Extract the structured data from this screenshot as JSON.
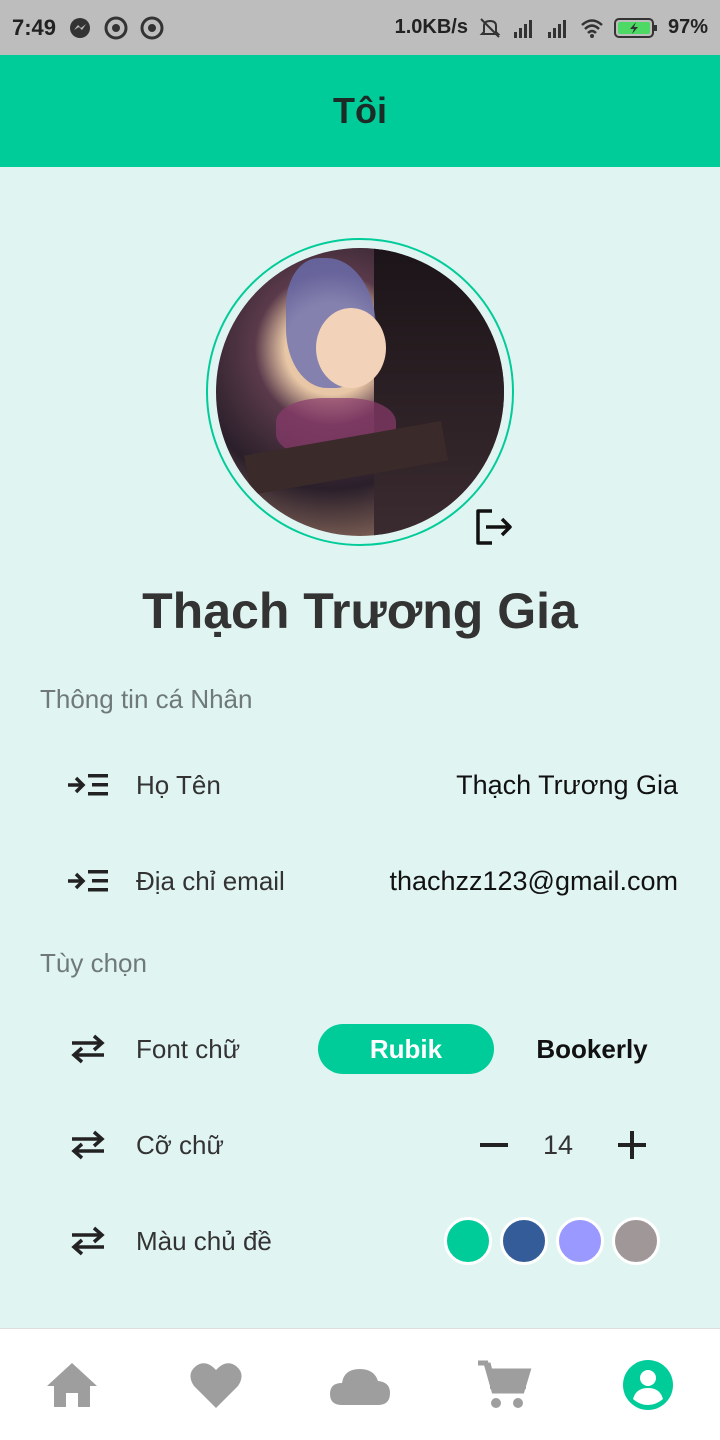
{
  "status_bar": {
    "time": "7:49",
    "network_speed": "1.0KB/s",
    "battery": "97%",
    "icons": [
      "messenger-icon",
      "app-icon",
      "app-icon",
      "mute-icon",
      "signal-icon",
      "signal-icon",
      "wifi-icon",
      "battery-icon"
    ]
  },
  "header": {
    "title": "Tôi"
  },
  "profile": {
    "name": "Thạch Trương Gia",
    "avatar": "avatar-image",
    "logout_icon": "logout-icon"
  },
  "personal_section": {
    "title": "Thông tin cá Nhân",
    "rows": [
      {
        "icon": "indent-icon",
        "label": "Họ Tên",
        "value": "Thạch Trương Gia"
      },
      {
        "icon": "indent-icon",
        "label": "Địa chỉ email",
        "value": "thachzz123@gmail.com"
      }
    ]
  },
  "options_section": {
    "title": "Tùy chọn",
    "font": {
      "icon": "swap-icon",
      "label": "Font chữ",
      "options": [
        "Rubik",
        "Bookerly"
      ],
      "selected": "Rubik"
    },
    "font_size": {
      "icon": "swap-icon",
      "label": "Cỡ chữ",
      "value": "14"
    },
    "theme_color": {
      "icon": "swap-icon",
      "label": "Màu chủ đề",
      "colors": [
        "#00cc99",
        "#335c99",
        "#9999ff",
        "#a09898"
      ],
      "selected_index": 0
    }
  },
  "bottom_nav": {
    "items": [
      {
        "icon": "home-icon",
        "active": false
      },
      {
        "icon": "heart-icon",
        "active": false
      },
      {
        "icon": "cloud-icon",
        "active": false
      },
      {
        "icon": "cart-icon",
        "active": false
      },
      {
        "icon": "account-icon",
        "active": true
      }
    ],
    "active_color": "#00cc99",
    "inactive_color": "#9e9e9e"
  },
  "colors": {
    "accent": "#00cc99",
    "background": "#e0f4f1"
  }
}
